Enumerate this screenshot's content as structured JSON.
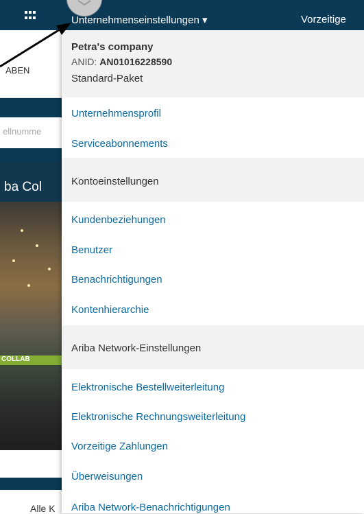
{
  "topbar": {
    "menu_trigger": "Unternehmenseinstellungen ▾",
    "right_nav": "Vorzeitige"
  },
  "background": {
    "section_label": "ABEN",
    "search_placeholder": "ellnumme",
    "promo_text": "ba Col",
    "photo_label": "COLLAB",
    "bottom_link": "Alle K"
  },
  "dropdown": {
    "company_name": "Petra's company",
    "anid_label": "ANID: ",
    "anid_value": "AN01016228590",
    "package": "Standard-Paket",
    "items_top": [
      "Unternehmensprofil",
      "Serviceabonnements"
    ],
    "section_account": "Kontoeinstellungen",
    "items_account": [
      "Kundenbeziehungen",
      "Benutzer",
      "Benachrichtigungen",
      "Kontenhierarchie"
    ],
    "section_network": "Ariba Network-Einstellungen",
    "items_network": [
      "Elektronische Bestellweiterleitung",
      "Elektronische Rechnungsweiterleitung",
      "Vorzeitige Zahlungen",
      "Überweisungen",
      "Ariba Network-Benachrichtigungen"
    ]
  },
  "colors": {
    "navbar": "#0b3a57",
    "link": "#0a6aa1",
    "section_bg": "#f2f2f2"
  },
  "icons": [
    "app-grid-icon",
    "chevron-down-icon",
    "annotation-arrow"
  ]
}
